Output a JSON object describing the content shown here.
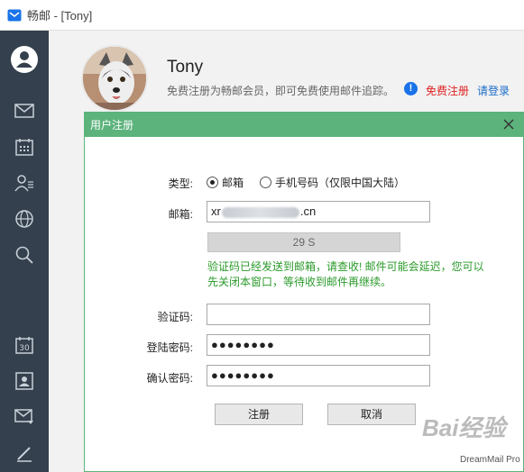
{
  "window": {
    "title": "畅邮 - [Tony]"
  },
  "sidebar": {
    "items": [
      {
        "icon": "user-circle-icon"
      },
      {
        "icon": "mail-icon"
      },
      {
        "icon": "calendar-icon"
      },
      {
        "icon": "contacts-icon"
      },
      {
        "icon": "globe-icon"
      },
      {
        "icon": "search-icon"
      },
      {
        "icon": "calendar-30-icon",
        "text": "30"
      },
      {
        "icon": "contact-card-icon"
      },
      {
        "icon": "mail-filter-icon"
      },
      {
        "icon": "compose-pen-icon"
      }
    ]
  },
  "profile": {
    "name": "Tony",
    "promo_text": "免费注册为畅邮会员，即可免费使用邮件追踪。",
    "register_link": "免费注册",
    "login_link": "请登录"
  },
  "dialog": {
    "title": "用户注册",
    "type_label": "类型:",
    "type_options": [
      "邮箱",
      "手机号码（仅限中国大陆）"
    ],
    "type_selected": "邮箱",
    "email_label": "邮箱:",
    "email_prefix": "xr",
    "email_suffix": ".cn",
    "countdown": "29 S",
    "notice_line1": "验证码已经发送到邮箱，请查收! 邮件可能会延迟，您可以",
    "notice_line2": "先关闭本窗口，等待收到邮件再继续。",
    "code_label": "验证码:",
    "code_value": "",
    "password_label": "登陆密码:",
    "password_value": "●●●●●●●●",
    "confirm_label": "确认密码:",
    "confirm_value": "●●●●●●●●",
    "register_button": "注册",
    "cancel_button": "取消"
  },
  "watermark": {
    "text": "Bai经验",
    "sub": "DreamMail Pro"
  },
  "colors": {
    "sidebar": "#34404d",
    "dialog_header": "#5cb37c",
    "notice_green": "#2a9a2a",
    "register_red": "#e02020",
    "login_blue": "#1a6cc8"
  }
}
